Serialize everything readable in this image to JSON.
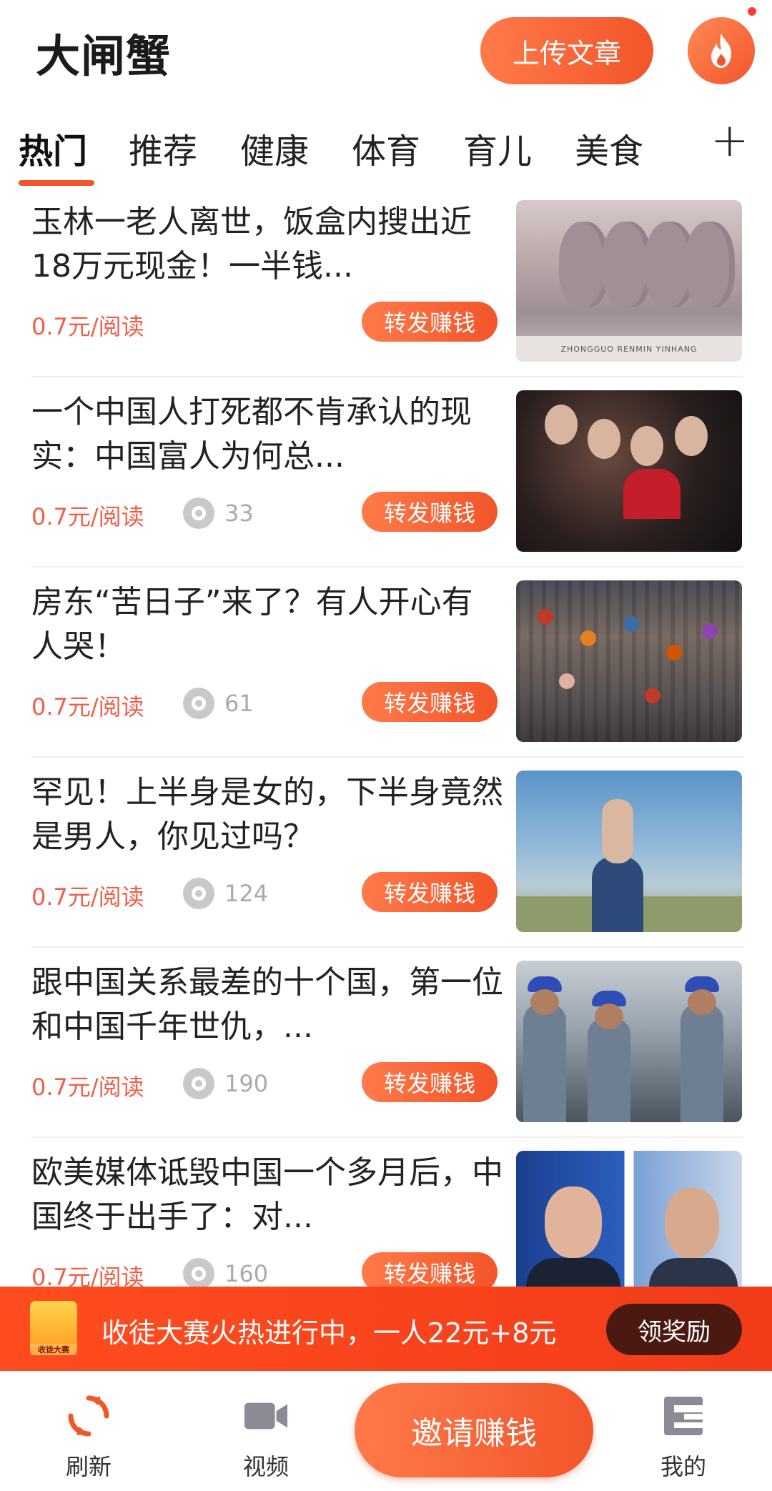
{
  "header": {
    "title": "大闸蟹",
    "upload_label": "上传文章"
  },
  "tabs": [
    {
      "label": "热门",
      "active": true
    },
    {
      "label": "推荐"
    },
    {
      "label": "健康"
    },
    {
      "label": "体育"
    },
    {
      "label": "育儿"
    },
    {
      "label": "美食"
    }
  ],
  "add_tab_label": "+",
  "articles": [
    {
      "title": "玉林一老人离世，饭盒内搜出近18万元现金！一半钱...",
      "price": "0.7元/阅读",
      "views": "",
      "share_label": "转发赚钱",
      "image_icon": "banknote-image",
      "banknote_caption": "ZHONGGUO  RENMIN  YINHANG"
    },
    {
      "title": "一个中国人打死都不肯承认的现实：中国富人为何总...",
      "price": "0.7元/阅读",
      "views": "33",
      "share_label": "转发赚钱",
      "image_icon": "party-image"
    },
    {
      "title": "房东“苦日子”来了？有人开心有人哭！",
      "price": "0.7元/阅读",
      "views": "61",
      "share_label": "转发赚钱",
      "image_icon": "crowd-image"
    },
    {
      "title": "罕见！上半身是女的，下半身竟然是男人，你见过吗？",
      "price": "0.7元/阅读",
      "views": "124",
      "share_label": "转发赚钱",
      "image_icon": "field-image"
    },
    {
      "title": "跟中国关系最差的十个国，第一位和中国千年世仇，...",
      "price": "0.7元/阅读",
      "views": "190",
      "share_label": "转发赚钱",
      "image_icon": "police-image"
    },
    {
      "title": "欧美媒体诋毁中国一个多月后，中国终于出手了：对...",
      "price": "0.7元/阅读",
      "views": "160",
      "share_label": "转发赚钱",
      "image_icon": "tv-anchors-image"
    }
  ],
  "promo": {
    "icon_label": "收徒大赛",
    "text": "收徒大赛火热进行中，一人22元+8元",
    "button_label": "领奖励"
  },
  "bottom_nav": {
    "refresh_label": "刷新",
    "video_label": "视频",
    "invite_label": "邀请赚钱",
    "mine_label": "我的"
  },
  "colors": {
    "accent": "#f2552a",
    "price": "#f05f4a",
    "promo_bg": "#ff4d1f",
    "promo_button": "#4a1a12"
  }
}
